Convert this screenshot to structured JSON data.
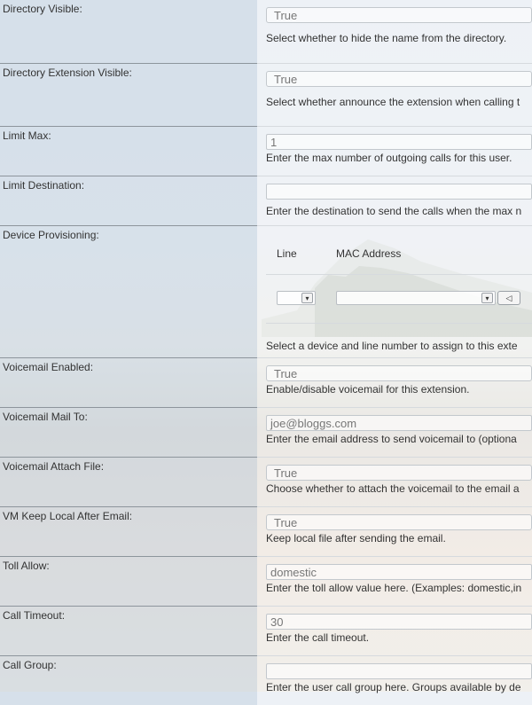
{
  "fields": {
    "directory_visible": {
      "label": "Directory Visible:",
      "value": "True",
      "desc": "Select whether to hide the name from the directory."
    },
    "directory_ext_visible": {
      "label": "Directory Extension Visible:",
      "value": "True",
      "desc": "Select whether announce the extension when calling t"
    },
    "limit_max": {
      "label": "Limit Max:",
      "value": "1",
      "desc": "Enter the max number of outgoing calls for this user."
    },
    "limit_destination": {
      "label": "Limit Destination:",
      "value": "",
      "desc": "Enter the destination to send the calls when the max n"
    },
    "device_provisioning": {
      "label": "Device Provisioning:",
      "col_line": "Line",
      "col_mac": "MAC Address",
      "line_value": "",
      "mac_value": "",
      "desc": "Select a device and line number to assign to this exte"
    },
    "voicemail_enabled": {
      "label": "Voicemail Enabled:",
      "value": "True",
      "desc": "Enable/disable voicemail for this extension."
    },
    "voicemail_mail_to": {
      "label": "Voicemail Mail To:",
      "placeholder": "joe@bloggs.com",
      "desc": "Enter the email address to send voicemail to (optiona"
    },
    "voicemail_attach_file": {
      "label": "Voicemail Attach File:",
      "value": "True",
      "desc": "Choose whether to attach the voicemail to the email a"
    },
    "vm_keep_local": {
      "label": "VM Keep Local After Email:",
      "value": "True",
      "desc": "Keep local file after sending the email."
    },
    "toll_allow": {
      "label": "Toll Allow:",
      "placeholder": "domestic",
      "desc": "Enter the toll allow value here. (Examples: domestic,in"
    },
    "call_timeout": {
      "label": "Call Timeout:",
      "value": "30",
      "desc": "Enter the call timeout."
    },
    "call_group": {
      "label": "Call Group:",
      "value": "",
      "desc": "Enter the user call group here. Groups available by de"
    }
  }
}
